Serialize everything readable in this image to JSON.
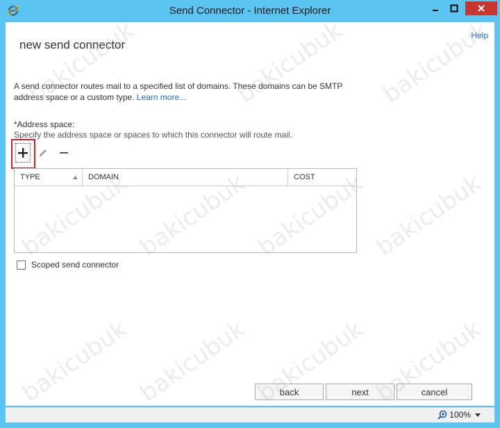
{
  "window": {
    "title": "Send Connector - Internet Explorer",
    "controls": {
      "minimize": "minimize",
      "maximize": "maximize",
      "close": "close"
    }
  },
  "header": {
    "help_label": "Help",
    "page_title": "new send connector"
  },
  "description": {
    "text": "A send connector routes mail to a specified list of domains. These domains can be SMTP address space or a custom type.",
    "link_text": "Learn more..."
  },
  "address_space": {
    "label": "*Address space:",
    "hint": "Specify the address space or spaces to which this connector will route mail.",
    "toolbar": {
      "add_icon": "plus-icon",
      "edit_icon": "pencil-icon",
      "remove_icon": "minus-icon"
    },
    "columns": [
      "TYPE",
      "DOMAIN",
      "COST"
    ],
    "rows": []
  },
  "scoped": {
    "label": "Scoped send connector",
    "checked": false
  },
  "footer": {
    "back_label": "back",
    "next_label": "next",
    "cancel_label": "cancel"
  },
  "statusbar": {
    "zoom": "100%"
  },
  "colors": {
    "title_bar": "#5bc4f0",
    "close_button": "#c7352f",
    "link": "#1b6ac9",
    "highlight": "#d0202a"
  },
  "watermark": "bakicubuk"
}
